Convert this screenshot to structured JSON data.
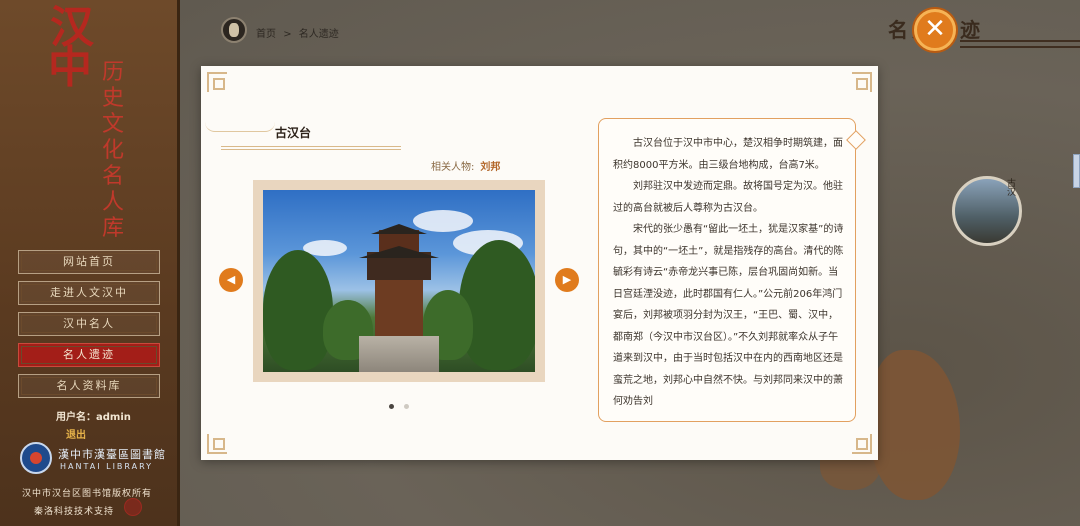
{
  "sidebar": {
    "brand_han": "汉",
    "brand_zhong": "中",
    "brand_vertical": "历史文化名人库",
    "nav": [
      {
        "label": "网站首页",
        "active": false
      },
      {
        "label": "走进人文汉中",
        "active": false
      },
      {
        "label": "汉中名人",
        "active": false
      },
      {
        "label": "名人遗迹",
        "active": true
      },
      {
        "label": "名人资料库",
        "active": false
      }
    ],
    "user_label": "用户名：admin",
    "logout_label": "退出",
    "library_name": "漢中市漢臺區圖書館",
    "library_en": "HANTAI LIBRARY",
    "copyright": "汉中市汉台区图书馆版权所有",
    "support": "秦洛科技技术支持"
  },
  "breadcrumb": {
    "home": "首页",
    "separator": ">",
    "current": "名人遗迹"
  },
  "header": {
    "section_title": "名人遗迹",
    "close_icon": "close-icon"
  },
  "side_thumb": {
    "label": "古汉"
  },
  "modal": {
    "site_title": "古汉台",
    "related_label": "相关人物:",
    "related_person": "刘邦",
    "prev_icon": "chevron-left-icon",
    "next_icon": "chevron-right-icon",
    "slide_count": 2,
    "active_slide": 1,
    "paragraphs": [
      "古汉台位于汉中市中心，楚汉相争时期筑建，面积约8000平方米。由三级台地构成，台高7米。",
      "刘邦驻汉中发迹而定鼎。故将国号定为汉。他驻过的高台就被后人尊称为古汉台。",
      "宋代的张少愚有“留此一坯土，犹是汉家基”的诗句，其中的“一坯土”，就是指残存的高台。清代的陈毓彩有诗云“赤帝龙兴事已陈，层台巩固尚如新。当日宫廷湮没迹，此时郡国有仁人。”公元前206年鸿门宴后，刘邦被项羽分封为汉王，“王巴、蜀、汉中，都南郑（今汉中市汉台区）。”不久刘邦就率众从子午道来到汉中，由于当时包括汉中在内的西南地区还是蛮荒之地，刘邦心中自然不快。与刘邦同来汉中的萧何劝告刘"
    ]
  },
  "colors": {
    "accent_orange": "#e07b1d",
    "active_red": "#a31e18",
    "sidebar_brown": "#5a3a20"
  }
}
